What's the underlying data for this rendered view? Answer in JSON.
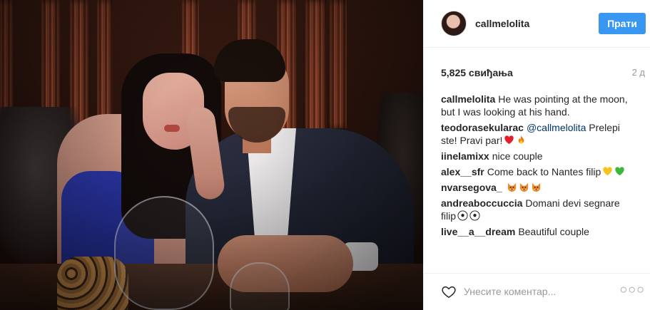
{
  "post": {
    "photo_alt": "",
    "header": {
      "username": "callmelolita",
      "follow_label": "Прати"
    },
    "likes": "5,825 свиђања",
    "time": "2 д",
    "comments": [
      {
        "user": "callmelolita",
        "text": "He was pointing at the moon, but I was looking at his hand.",
        "mention": "",
        "emojis": []
      },
      {
        "user": "teodorasekularac",
        "mention": "@callmelolita",
        "text": " Prelepi ste! Pravi par!",
        "emojis": [
          "red-heart",
          "fire"
        ]
      },
      {
        "user": "iinelamixx",
        "text": "nice couple",
        "mention": "",
        "emojis": []
      },
      {
        "user": "alex__sfr",
        "text": "Come back to Nantes filip",
        "mention": "",
        "emojis": [
          "yellow-heart",
          "green-heart"
        ]
      },
      {
        "user": "nvarsegova_",
        "text": "",
        "mention": "",
        "emojis": [
          "fox",
          "fox",
          "fox"
        ]
      },
      {
        "user": "andreaboccuccia",
        "text": "Domani devi segnare filip",
        "mention": "",
        "emojis": [
          "soccer-ball",
          "soccer-ball"
        ]
      },
      {
        "user": "live__a__dream",
        "text": "Beautiful couple",
        "mention": "",
        "emojis": []
      }
    ],
    "footer": {
      "comment_placeholder": "Унесите коментар...",
      "more_label": "○○○"
    }
  },
  "colors": {
    "accent": "#3897f0",
    "text": "#262626",
    "muted": "#999999"
  }
}
